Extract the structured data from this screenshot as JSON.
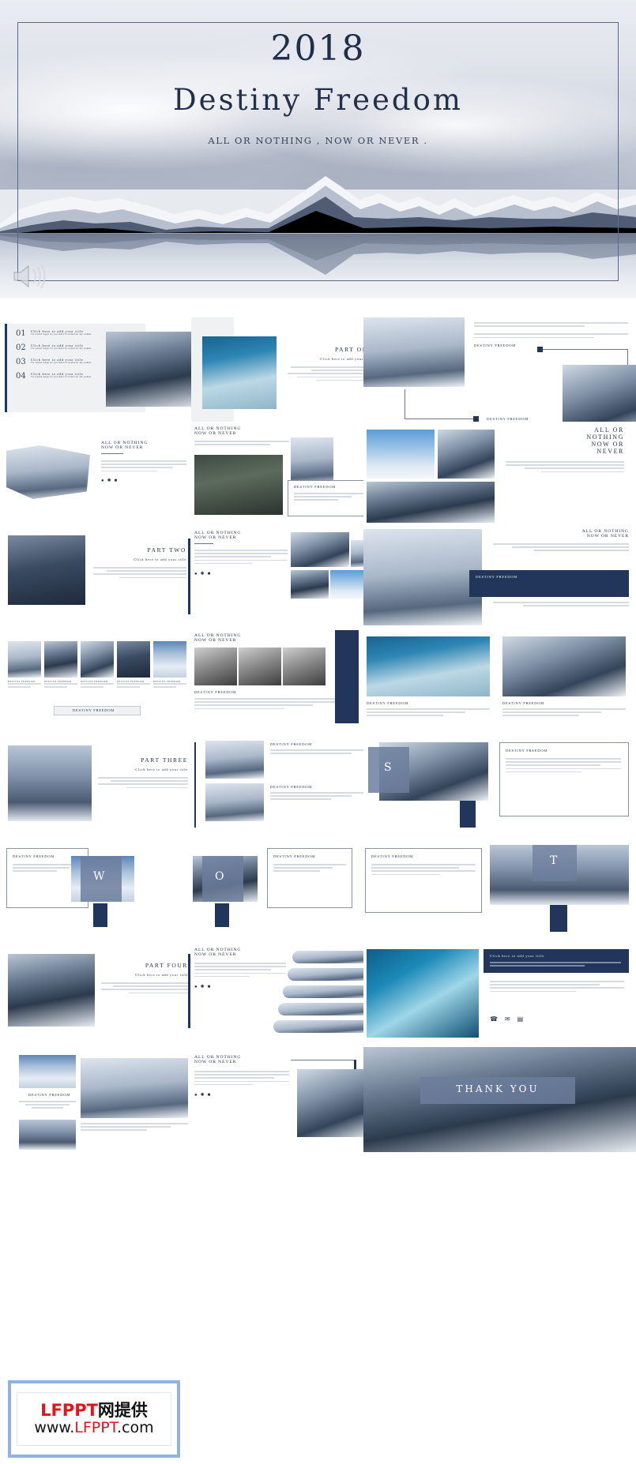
{
  "hero": {
    "year": "2018",
    "title": "Destiny Freedom",
    "subtitle": "ALL OR NOTHING , NOW OR NEVER .",
    "audio_icon": "speaker-icon",
    "frame_color": "#5d6a84",
    "text_color": "#22304c"
  },
  "common": {
    "body_text": "I love you more than I've ever loved any woman. And I've waited longer for you than I've waited for any woman.",
    "cta_title": "Click here to add your title",
    "brand": "DESTINY FREEDOM",
    "tagline_line1": "ALL OR NOTHING",
    "tagline_line2": "NOW OR NEVER",
    "accent": "#22365c",
    "accent_light": "#6c7e9e"
  },
  "agenda": {
    "items": [
      {
        "num": "01",
        "title": "Click here to add your title",
        "desc": "I've waited longer for you than I've waited for any woman."
      },
      {
        "num": "02",
        "title": "Click here to add your title",
        "desc": "I've waited longer for you than I've waited for any woman."
      },
      {
        "num": "03",
        "title": "Click here to add your title",
        "desc": "I've waited longer for you than I've waited for any woman."
      },
      {
        "num": "04",
        "title": "Click here to add your title",
        "desc": "I've waited longer for you than I've waited for any woman."
      }
    ]
  },
  "sections": {
    "part_one": "PART ONE",
    "part_two": "PART TWO",
    "part_three": "PART THREE",
    "part_four": "PART FOUR"
  },
  "swot": {
    "s": "S",
    "w": "W",
    "o": "O",
    "t": "T"
  },
  "closing": {
    "thank_you": "THANK YOU"
  },
  "watermark": {
    "line1_red": "LFPPT",
    "line1_black": "网提供",
    "line2_prefix": "www.",
    "line2_red": "LFPPT",
    "line2_suffix": ".com",
    "border_color": "#8fb3e0",
    "red": "#e8121b"
  }
}
